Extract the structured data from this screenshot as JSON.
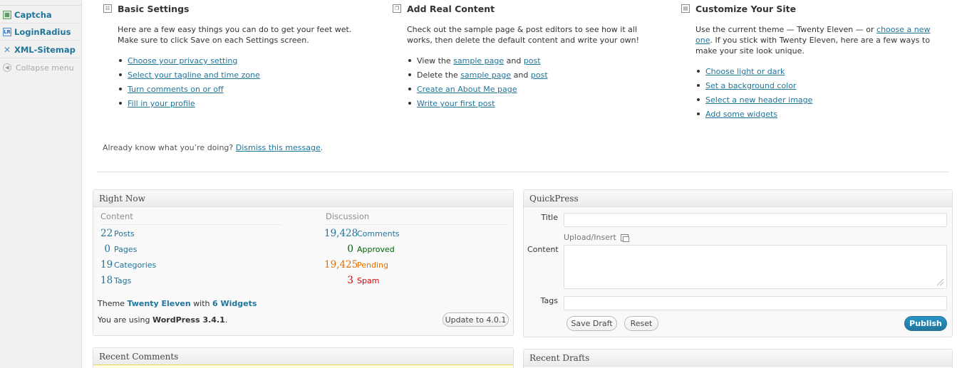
{
  "sidebar": {
    "items": [
      {
        "label": "Captcha",
        "icon": "captcha-icon"
      },
      {
        "label": "LoginRadius",
        "icon": "loginradius-icon"
      },
      {
        "label": "XML-Sitemap",
        "icon": "xml-sitemap-icon"
      }
    ],
    "collapse_label": "Collapse menu"
  },
  "welcome": {
    "basic": {
      "title": "Basic Settings",
      "text": "Here are a few easy things you can do to get your feet wet. Make sure to click Save on each Settings screen.",
      "links": [
        "Choose your privacy setting",
        "Select your tagline and time zone",
        "Turn comments on or off",
        "Fill in your profile"
      ]
    },
    "content": {
      "title": "Add Real Content",
      "text": "Check out the sample page & post editors to see how it all works, then delete the default content and write your own!",
      "view_prefix": "View the",
      "delete_prefix": "Delete the",
      "and": "and",
      "sample_page": "sample page",
      "post": "post",
      "links": [
        "Create an About Me page",
        "Write your first post"
      ]
    },
    "customize": {
      "title": "Customize Your Site",
      "text_before": "Use the current theme — Twenty Eleven — or",
      "choose_link": "choose a new one",
      "text_after": ". If you stick with Twenty Eleven, here are a few ways to make your site look unique.",
      "links": [
        "Choose light or dark",
        "Set a background color",
        "Select a new header image",
        "Add some widgets"
      ]
    },
    "already_text": "Already know what you’re doing?",
    "dismiss_link": "Dismiss this message",
    "period": "."
  },
  "right_now": {
    "title": "Right Now",
    "content_heading": "Content",
    "discussion_heading": "Discussion",
    "content": [
      {
        "num": "22",
        "label": "Posts"
      },
      {
        "num": "0",
        "label": "Pages"
      },
      {
        "num": "19",
        "label": "Categories"
      },
      {
        "num": "18",
        "label": "Tags"
      }
    ],
    "discussion": [
      {
        "num": "19,428",
        "label": "Comments"
      },
      {
        "num": "0",
        "label": "Approved"
      },
      {
        "num": "19,425",
        "label": "Pending"
      },
      {
        "num": "3",
        "label": "Spam"
      }
    ],
    "theme_prefix": "Theme",
    "theme_name": "Twenty Eleven",
    "theme_with": "with",
    "widgets": "6 Widgets",
    "using_prefix": "You are using",
    "version": "WordPress 3.4.1",
    "update_button": "Update to 4.0.1"
  },
  "quickpress": {
    "title": "QuickPress",
    "title_label": "Title",
    "upload_label": "Upload/Insert",
    "content_label": "Content",
    "tags_label": "Tags",
    "title_value": "",
    "content_value": "",
    "tags_value": "",
    "save_draft": "Save Draft",
    "reset": "Reset",
    "publish": "Publish"
  },
  "recent_comments": {
    "title": "Recent Comments"
  },
  "recent_drafts": {
    "title": "Recent Drafts"
  },
  "colors": {
    "link": "#21759b",
    "approved": "#006505",
    "pending": "#e66f00",
    "spam": "#dd0000",
    "primary_button": "#21759b"
  }
}
